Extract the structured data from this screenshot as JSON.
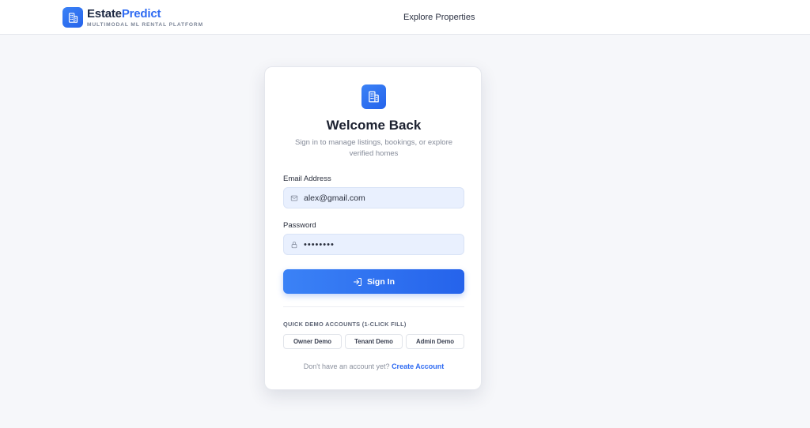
{
  "header": {
    "brand_part1": "Estate",
    "brand_part2": "Predict",
    "tagline": "MULTIMODAL ML RENTAL PLATFORM",
    "nav_link": "Explore Properties",
    "logo_icon": "building-icon"
  },
  "login": {
    "title": "Welcome Back",
    "subtitle": "Sign in to manage listings, bookings, or explore verified homes",
    "email_label": "Email Address",
    "email_value": "alex@gmail.com",
    "password_label": "Password",
    "password_value": "••••••••",
    "signin_label": "Sign In",
    "demo_heading": "QUICK DEMO ACCOUNTS (1-CLICK FILL)",
    "demo_buttons": [
      "Owner Demo",
      "Tenant Demo",
      "Admin Demo"
    ],
    "footer_text": "Don't have an account yet?",
    "footer_link": "Create Account"
  },
  "colors": {
    "accent": "#2f6bf2",
    "field_bg": "#e9f0fe",
    "page_bg": "#f6f7fa"
  }
}
